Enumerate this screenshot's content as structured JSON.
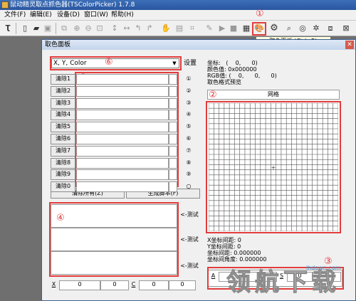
{
  "app": {
    "title": "鼠动精灵取点抓色器(TSColorPicker) 1.7.8"
  },
  "menu": [
    {
      "label": "文件(F)"
    },
    {
      "label": "编辑(E)"
    },
    {
      "label": "设备(D)"
    },
    {
      "label": "窗口(W)"
    },
    {
      "label": "帮助(H)"
    }
  ],
  "toolbar": {
    "tooltip": "取色面板 (Ctrl+R)",
    "icons": [
      "ts-logo-icon",
      "new-file-icon",
      "open-folder-icon",
      "save-icon",
      "copy-icon",
      "zoom-in-icon",
      "zoom-out-icon",
      "fit-icon",
      "vertical-arrows-icon",
      "horizontal-arrows-icon",
      "undo-icon",
      "redo-icon",
      "hand-icon",
      "image-icon",
      "crop-icon",
      "pen-icon",
      "play-icon",
      "stop-icon",
      "list-icon",
      "color-palette-icon",
      "gear-icon",
      "find-icon",
      "find-color-icon",
      "settings-icon",
      "window-icon"
    ]
  },
  "markers": {
    "m1": "①",
    "m2": "②",
    "m3": "③",
    "m4": "④",
    "m5": "⑤",
    "m6": "⑥"
  },
  "panel": {
    "title": "取色面板",
    "close": "✕",
    "format_select": "X, Y, Color",
    "format_arrow": "▼",
    "settings_label": "设置",
    "clear_rows": [
      {
        "label": "清除1",
        "num": "①"
      },
      {
        "label": "清除2",
        "num": "②"
      },
      {
        "label": "清除3",
        "num": "③"
      },
      {
        "label": "清除4",
        "num": "④"
      },
      {
        "label": "清除5",
        "num": "⑤"
      },
      {
        "label": "清除6",
        "num": "⑥"
      },
      {
        "label": "清除7",
        "num": "⑦"
      },
      {
        "label": "清除8",
        "num": "⑧"
      },
      {
        "label": "清除9",
        "num": "⑨"
      },
      {
        "label": "清除0",
        "num": "○"
      }
    ],
    "clear_all": "清除所有(Z)",
    "generate_script": "生成脚本(F)",
    "test_label": "<-测试",
    "bottom": {
      "x_label": "X",
      "x_value1": "0",
      "x_value2": "0",
      "c_label": "C",
      "c_value1": "0",
      "c_value2": "0"
    },
    "info": {
      "coords": "坐标:   (    0,      0)",
      "color_value": "颜色值: 0x000000",
      "rgb": "RGB值: (    0,      0,      0)",
      "format_preview": "取色格式预览"
    },
    "grid_label": "网格",
    "grid": {
      "cols": 25,
      "rows": 25,
      "center": "+"
    },
    "lower_info": {
      "x_spacing": "X坐标间距: 0",
      "y_spacing": "Y坐标间距: 0",
      "coord_spacing": "坐标间距: 0.000000",
      "coord_angle": "坐标间角度: 0.000000"
    },
    "bottom_right": {
      "a_label": "A",
      "s_label": "S",
      "s_value": "0",
      "r_value": "0"
    }
  },
  "watermark": {
    "url": "lhdown.com",
    "text": "领航下载"
  }
}
